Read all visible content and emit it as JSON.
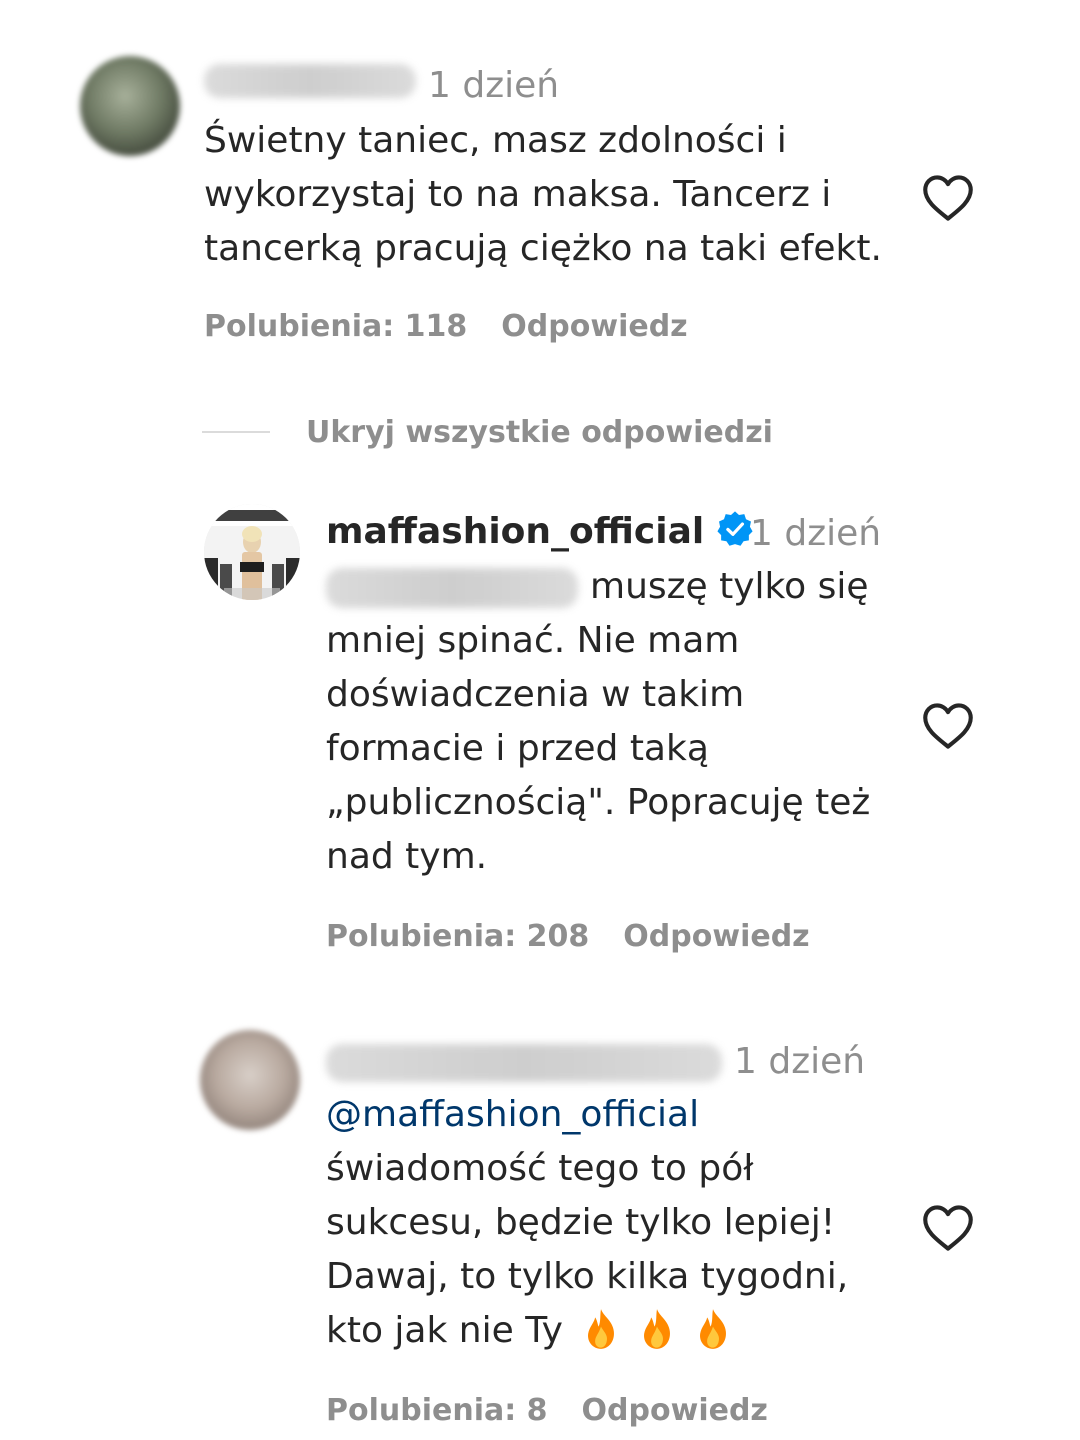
{
  "comments": [
    {
      "time": "1 dzień",
      "lines": [
        "Świetny taniec, masz zdolności i",
        "wykorzystaj to na maksa. Tancerz i",
        "tancerką pracują ciężko na taki efekt."
      ],
      "likes": "Polubienia: 118",
      "reply": "Odpowiedz"
    },
    {
      "username": "maffashion_official",
      "time": "1 dzień",
      "lines": [
        "muszę tylko się",
        "mniej spinać. Nie mam",
        "doświadczenia w takim",
        "formacie i przed taką",
        "„publicznością\". Popracuję też",
        "nad tym."
      ],
      "likes": "Polubienia: 208",
      "reply": "Odpowiedz"
    },
    {
      "time": "1 dzień",
      "mention": "@maffashion_official",
      "lines": [
        "świadomość tego to pół",
        "sukcesu, będzie tylko lepiej!",
        "Dawaj, to tylko kilka tygodni,",
        "kto jak nie Ty"
      ],
      "likes": "Polubienia: 8",
      "reply": "Odpowiedz"
    }
  ],
  "hide_replies": "Ukryj wszystkie odpowiedzi",
  "icons": {
    "heart": "heart-icon",
    "verified": "verified-badge-icon",
    "fire": "fire-emoji-icon"
  },
  "colors": {
    "text": "#262626",
    "muted": "#8e8e8e",
    "verified": "#0095f6",
    "mention": "#00376b",
    "fire": "#ff8a00"
  }
}
